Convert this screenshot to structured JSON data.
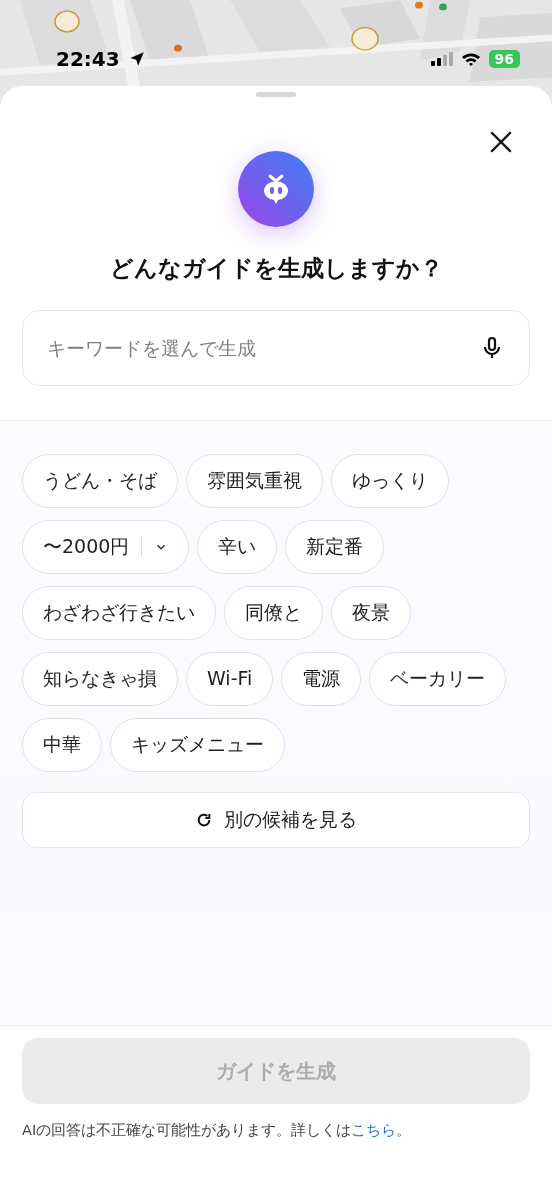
{
  "status_bar": {
    "time": "22:43",
    "battery": "96"
  },
  "sheet": {
    "title": "どんなガイドを生成しますか？",
    "search": {
      "placeholder": "キーワードを選んで生成"
    },
    "chips": [
      {
        "label": "うどん・そば",
        "kind": "chip"
      },
      {
        "label": "雰囲気重視",
        "kind": "chip"
      },
      {
        "label": "ゆっくり",
        "kind": "chip"
      },
      {
        "label": "〜2000円",
        "kind": "dropdown"
      },
      {
        "label": "辛い",
        "kind": "chip"
      },
      {
        "label": "新定番",
        "kind": "chip"
      },
      {
        "label": "わざわざ行きたい",
        "kind": "chip"
      },
      {
        "label": "同僚と",
        "kind": "chip"
      },
      {
        "label": "夜景",
        "kind": "chip"
      },
      {
        "label": "知らなきゃ損",
        "kind": "chip"
      },
      {
        "label": "Wi-Fi",
        "kind": "chip"
      },
      {
        "label": "電源",
        "kind": "chip"
      },
      {
        "label": "ベーカリー",
        "kind": "chip"
      },
      {
        "label": "中華",
        "kind": "chip"
      },
      {
        "label": "キッズメニュー",
        "kind": "chip"
      }
    ],
    "refresh_button": "別の候補を見る",
    "generate_button": {
      "label": "ガイドを生成",
      "disabled": true
    },
    "disclaimer": {
      "text": "AIの回答は不正確な可能性があります。詳しくは",
      "link": "こちら",
      "tail": "。"
    }
  }
}
